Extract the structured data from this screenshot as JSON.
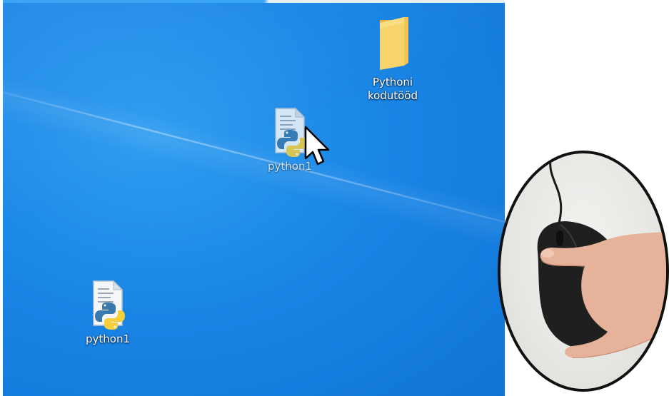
{
  "desktop": {
    "background_color": "#1a86e6",
    "icons": [
      {
        "label": "Pythoni\nkodutööd",
        "icon": "folder-icon",
        "color": "#f3c94f"
      },
      {
        "label": "python1",
        "icon": "python-file-icon",
        "state": "being-dragged"
      },
      {
        "label": "python1",
        "icon": "python-file-icon"
      }
    ]
  },
  "cursor": {
    "icon": "arrow-cursor-icon"
  },
  "inset_photo": {
    "subject": "hand-holding-mouse",
    "mouse_color": "#1c1c1c"
  }
}
